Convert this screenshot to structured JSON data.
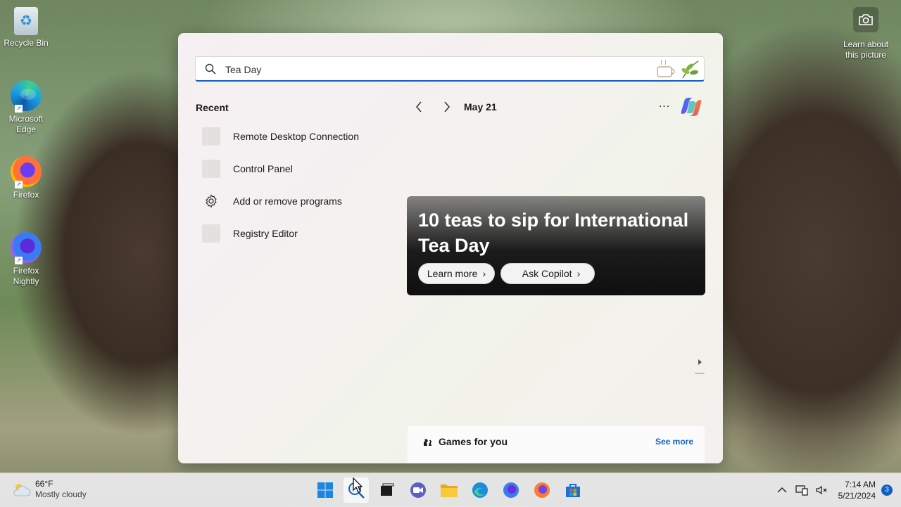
{
  "desktop": {
    "icons": [
      {
        "label": "Recycle Bin"
      },
      {
        "label": "Microsoft Edge"
      },
      {
        "label": "Firefox"
      },
      {
        "label": "Firefox Nightly"
      }
    ],
    "learn_picture": "Learn about this picture"
  },
  "search": {
    "value": "Tea Day",
    "recent_title": "Recent",
    "recent_items": [
      {
        "label": "Remote Desktop Connection",
        "icon": "app-icon"
      },
      {
        "label": "Control Panel",
        "icon": "control-panel-icon"
      },
      {
        "label": "Add or remove programs",
        "icon": "gear-icon"
      },
      {
        "label": "Registry Editor",
        "icon": "registry-icon"
      }
    ],
    "date": "May 21",
    "more": "...",
    "hero": {
      "title": "10 teas to sip for International Tea Day",
      "learn_more": "Learn more",
      "ask_copilot": "Ask Copilot"
    },
    "games": {
      "title": "Games for you",
      "see_more": "See more"
    }
  },
  "taskbar": {
    "weather": {
      "temp": "66°F",
      "condition": "Mostly cloudy"
    },
    "apps": [
      "start",
      "search",
      "task-view",
      "teams-meet",
      "file-explorer",
      "edge",
      "firefox-nightly",
      "firefox",
      "store"
    ],
    "time": "7:14 AM",
    "date": "5/21/2024",
    "notification_count": "3"
  },
  "colors": {
    "accent": "#0f5fc7"
  }
}
